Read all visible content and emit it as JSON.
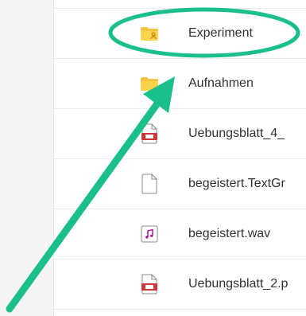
{
  "files": [
    {
      "name": "Experiment",
      "icon": "shared-folder-icon"
    },
    {
      "name": "Aufnahmen",
      "icon": "folder-icon"
    },
    {
      "name": "Uebungsblatt_4_",
      "icon": "pdf-file-icon"
    },
    {
      "name": "begeistert.TextGr",
      "icon": "generic-file-icon"
    },
    {
      "name": "begeistert.wav",
      "icon": "audio-file-icon"
    },
    {
      "name": "Uebungsblatt_2.p",
      "icon": "pdf-file-icon"
    }
  ],
  "colors": {
    "annotation": "#1bbf8c",
    "folder": "#f8c342",
    "pdf": "#d13438",
    "audio": "#b4009e"
  }
}
